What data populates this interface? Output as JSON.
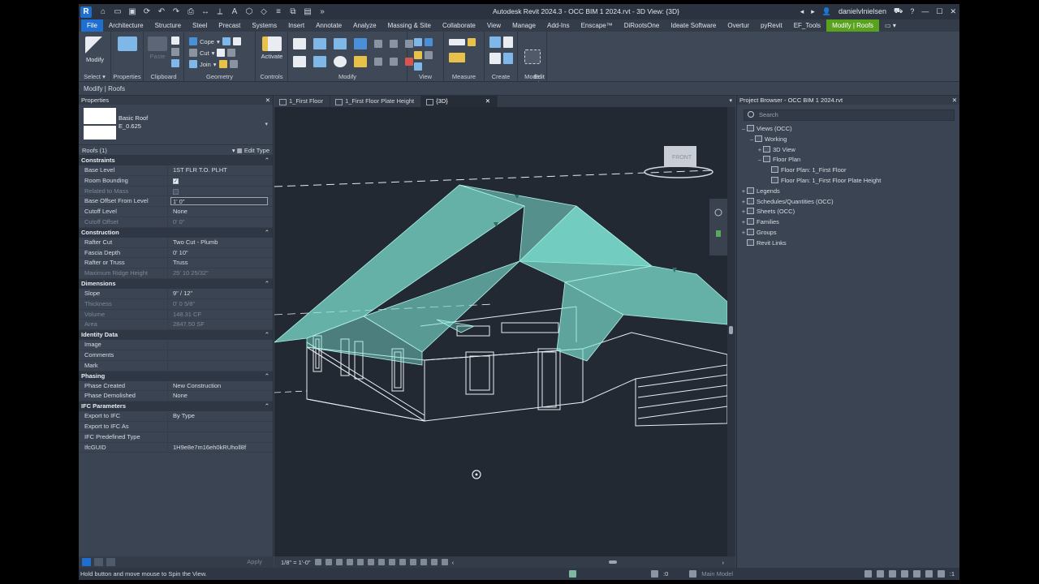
{
  "window": {
    "title": "Autodesk Revit 2024.3 - OCC BIM 1 2024.rvt - 3D View: {3D}",
    "user": "danielvlnielsen"
  },
  "ribbon_tabs": [
    "File",
    "Architecture",
    "Structure",
    "Steel",
    "Precast",
    "Systems",
    "Insert",
    "Annotate",
    "Analyze",
    "Massing & Site",
    "Collaborate",
    "View",
    "Manage",
    "Add-Ins",
    "Enscape™",
    "DiRootsOne",
    "Ideate Software",
    "Overtur",
    "pyRevit",
    "EF_Tools",
    "Modify | Roofs"
  ],
  "ribbon": {
    "modify": "Modify",
    "paste": "Paste",
    "cope": "Cope",
    "cut": "Cut",
    "join": "Join",
    "activate": "Activate",
    "edit_footprint": "Edit\nFootprint",
    "groups": {
      "select": "Select",
      "properties": "Properties",
      "clipboard": "Clipboard",
      "geometry": "Geometry",
      "controls": "Controls",
      "modify": "Modify",
      "view": "View",
      "measure": "Measure",
      "create": "Create",
      "mode": "Mode"
    }
  },
  "options_bar": "Modify | Roofs",
  "properties": {
    "header": "Properties",
    "type_family": "Basic Roof",
    "type_name": "E_0.625",
    "instance": "Roofs (1)",
    "edit_type": "Edit Type",
    "groups": [
      {
        "name": "Constraints",
        "rows": [
          {
            "k": "Base Level",
            "v": "1ST FLR T.O. PLHT"
          },
          {
            "k": "Room Bounding",
            "check": true
          },
          {
            "k": "Related to Mass",
            "check": false,
            "dim": true
          },
          {
            "k": "Base Offset From Level",
            "v": "1'  0\"",
            "boxed": true
          },
          {
            "k": "Cutoff Level",
            "v": "None"
          },
          {
            "k": "Cutoff Offset",
            "v": "0'  0\"",
            "dim": true
          }
        ]
      },
      {
        "name": "Construction",
        "rows": [
          {
            "k": "Rafter Cut",
            "v": "Two Cut - Plumb"
          },
          {
            "k": "Fascia Depth",
            "v": "0'  10\""
          },
          {
            "k": "Rafter or Truss",
            "v": "Truss"
          },
          {
            "k": "Maximum Ridge Height",
            "v": "25'  10 25/32\"",
            "dim": true
          }
        ]
      },
      {
        "name": "Dimensions",
        "rows": [
          {
            "k": "Slope",
            "v": "9\" / 12\""
          },
          {
            "k": "Thickness",
            "v": "0'  0 5/8\"",
            "dim": true
          },
          {
            "k": "Volume",
            "v": "148.31 CF",
            "dim": true
          },
          {
            "k": "Area",
            "v": "2847.50 SF",
            "dim": true
          }
        ]
      },
      {
        "name": "Identity Data",
        "rows": [
          {
            "k": "Image",
            "v": ""
          },
          {
            "k": "Comments",
            "v": ""
          },
          {
            "k": "Mark",
            "v": ""
          }
        ]
      },
      {
        "name": "Phasing",
        "rows": [
          {
            "k": "Phase Created",
            "v": "New Construction"
          },
          {
            "k": "Phase Demolished",
            "v": "None"
          }
        ]
      },
      {
        "name": "IFC Parameters",
        "rows": [
          {
            "k": "Export to IFC",
            "v": "By Type"
          },
          {
            "k": "Export to IFC As",
            "v": ""
          },
          {
            "k": "IFC Predefined Type",
            "v": ""
          },
          {
            "k": "IfcGUID",
            "v": "1H9e8e7m16eh0kRUholl8f"
          }
        ]
      }
    ],
    "apply": "Apply"
  },
  "view_tabs": [
    {
      "label": "1_First Floor",
      "active": false
    },
    {
      "label": "1_First Floor Plate Height",
      "active": false
    },
    {
      "label": "{3D}",
      "active": true
    }
  ],
  "viewcube_label": "FRONT",
  "view_scale": "1/8\" = 1'-0\"",
  "browser": {
    "header": "Project Browser - OCC BIM 1 2024.rvt",
    "search_placeholder": "Search",
    "nodes": [
      {
        "label": "Views (OCC)",
        "level": 0,
        "exp": "–"
      },
      {
        "label": "Working",
        "level": 1,
        "exp": "–"
      },
      {
        "label": "3D View",
        "level": 2,
        "exp": "+"
      },
      {
        "label": "Floor Plan",
        "level": 2,
        "exp": "–"
      },
      {
        "label": "Floor Plan: 1_First Floor",
        "level": 3,
        "exp": ""
      },
      {
        "label": "Floor Plan: 1_First Floor Plate Height",
        "level": 3,
        "exp": ""
      },
      {
        "label": "Legends",
        "level": 0,
        "exp": "+"
      },
      {
        "label": "Schedules/Quantities (OCC)",
        "level": 0,
        "exp": "+"
      },
      {
        "label": "Sheets (OCC)",
        "level": 0,
        "exp": "+"
      },
      {
        "label": "Families",
        "level": 0,
        "exp": "+"
      },
      {
        "label": "Groups",
        "level": 0,
        "exp": "+"
      },
      {
        "label": "Revit Links",
        "level": 0,
        "exp": ""
      }
    ]
  },
  "status": {
    "message": "Hold button and move mouse to Spin the View.",
    "zero": ":0",
    "model": "Main Model",
    "filter": ":1"
  },
  "colors": {
    "roof": "#7fe6d6",
    "accent_tab": "#58a21e",
    "file_tab": "#1f6fd1"
  }
}
